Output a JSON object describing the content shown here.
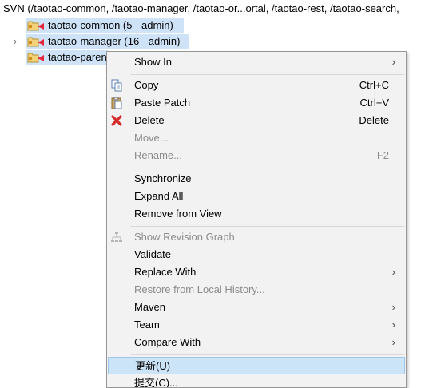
{
  "header": {
    "title": "SVN (/taotao-common, /taotao-manager, /taotao-or...ortal, /taotao-rest, /taotao-search,"
  },
  "tree": {
    "items": [
      {
        "label": "taotao-common (5 - admin)",
        "expander": ""
      },
      {
        "label": "taotao-manager (16 - admin)",
        "expander": "›"
      },
      {
        "label": "taotao-parent",
        "expander": ""
      }
    ]
  },
  "menu": {
    "items": [
      {
        "label": "Show In",
        "shortcut": "",
        "submenu": true
      },
      {
        "label": "Copy",
        "shortcut": "Ctrl+C",
        "icon": "copy-icon"
      },
      {
        "label": "Paste Patch",
        "shortcut": "Ctrl+V",
        "icon": "paste-icon"
      },
      {
        "label": "Delete",
        "shortcut": "Delete",
        "icon": "delete-icon"
      },
      {
        "label": "Move...",
        "shortcut": "",
        "disabled": true
      },
      {
        "label": "Rename...",
        "shortcut": "F2",
        "disabled": true
      },
      {
        "label": "Synchronize",
        "shortcut": ""
      },
      {
        "label": "Expand All",
        "shortcut": ""
      },
      {
        "label": "Remove from View",
        "shortcut": ""
      },
      {
        "label": "Show Revision Graph",
        "shortcut": "",
        "disabled": true,
        "icon": "revision-graph-icon"
      },
      {
        "label": "Validate",
        "shortcut": ""
      },
      {
        "label": "Replace With",
        "shortcut": "",
        "submenu": true
      },
      {
        "label": "Restore from Local History...",
        "shortcut": "",
        "disabled": true
      },
      {
        "label": "Maven",
        "shortcut": "",
        "submenu": true
      },
      {
        "label": "Team",
        "shortcut": "",
        "submenu": true
      },
      {
        "label": "Compare With",
        "shortcut": "",
        "submenu": true
      },
      {
        "label": "更新(U)",
        "shortcut": "",
        "highlighted": true
      },
      {
        "label": "提交(C)...",
        "shortcut": ""
      }
    ],
    "submenu_arrow": "›"
  },
  "colors": {
    "selection": "#cfe3f8",
    "menu_background": "#f2f2f2",
    "menu_highlight": "#cce4f7",
    "disabled_text": "#8c8c8c"
  }
}
